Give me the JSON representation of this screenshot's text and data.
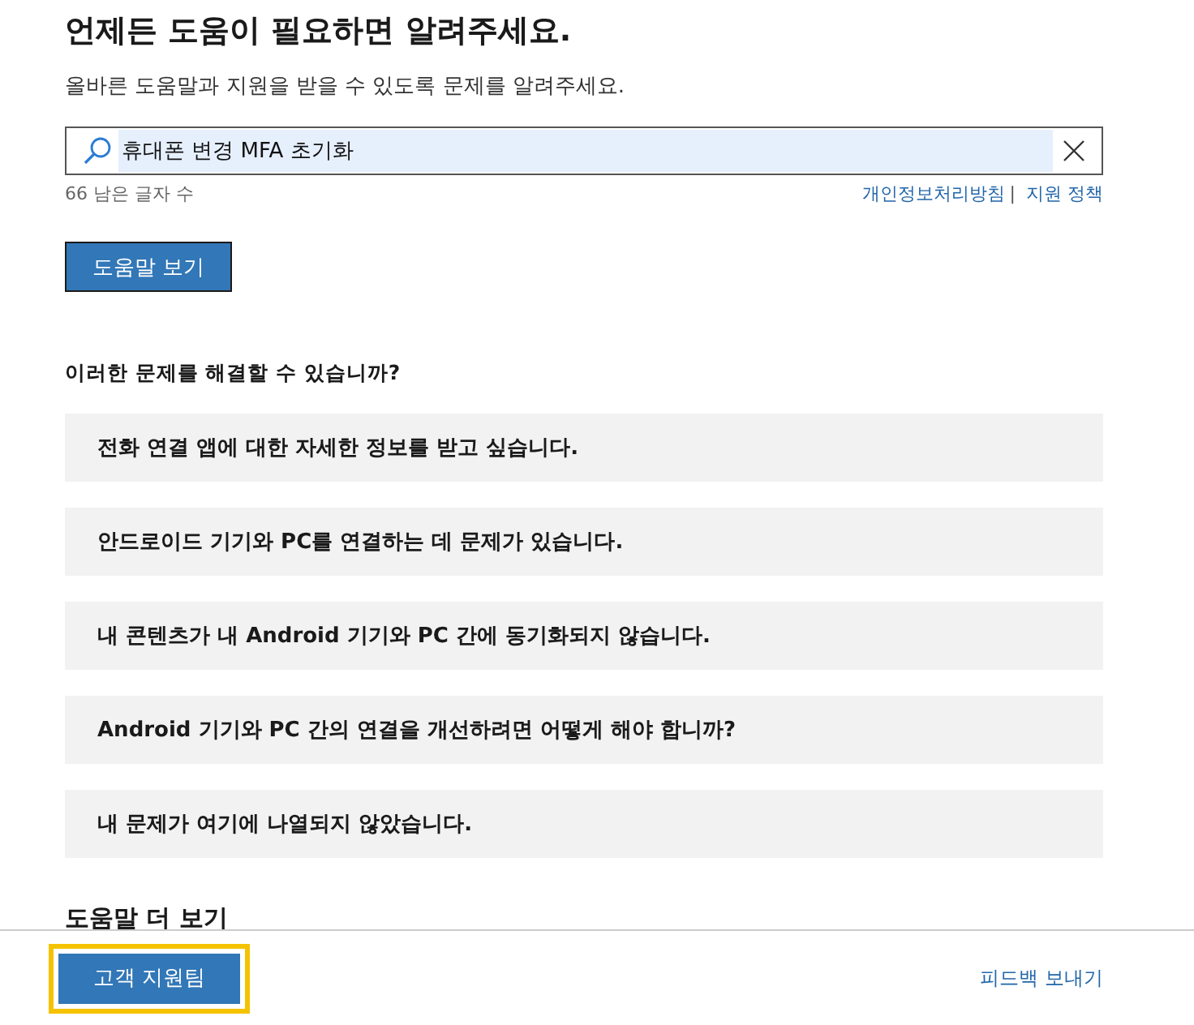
{
  "heading": "언제든 도움이 필요하면 알려주세요.",
  "subtitle": "올바른 도움말과 지원을 받을 수 있도록 문제를 알려주세요.",
  "search": {
    "value": "휴대폰 변경 MFA 초기화"
  },
  "char_count": "66 남은 글자 수",
  "links": [
    "개인정보처리방침",
    "지원 정책"
  ],
  "link_separator": "|",
  "help_button": "도움말 보기",
  "questions_heading": "이러한 문제를 해결할 수 있습니까?",
  "questions": [
    "전화 연결 앱에 대한 자세한 정보를 받고 싶습니다.",
    "안드로이드 기기와 PC를 연결하는 데 문제가 있습니다.",
    "내 콘텐츠가 내 Android 기기와 PC 간에 동기화되지 않습니다.",
    "Android 기기와 PC 간의 연결을 개선하려면 어떻게 해야 합니까?",
    "내 문제가 여기에 나열되지 않았습니다."
  ],
  "more_heading": "도움말 더 보기",
  "footer": {
    "support_button": "고객 지원팀",
    "support_focused": true,
    "feedback_link": "피드백 보내기"
  }
}
